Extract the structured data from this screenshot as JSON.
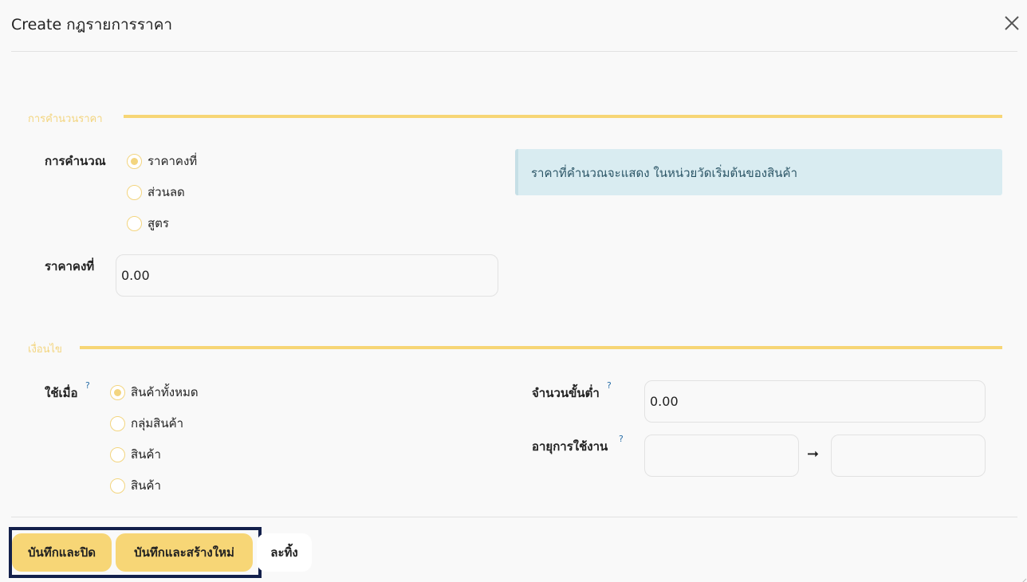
{
  "header": {
    "title": "Create กฎรายการราคา",
    "close_icon": "close-icon"
  },
  "section_calc": {
    "title": "การคำนวนราคา",
    "calc_label": "การคำนวณ",
    "options": [
      {
        "label": "ราคาคงที่",
        "checked": true
      },
      {
        "label": "ส่วนลด",
        "checked": false
      },
      {
        "label": "สูตร",
        "checked": false
      }
    ],
    "info_text": "ราคาที่คำนวณจะแสดง ในหน่วยวัดเริ่มต้นของสินค้า",
    "fixed_price_label": "ราคาคงที่",
    "fixed_price_value": "0.00"
  },
  "section_cond": {
    "title": "เงื่อนไข",
    "apply_label": "ใช้เมื่อ",
    "help_mark": "?",
    "options": [
      {
        "label": "สินค้าทั้งหมด",
        "checked": true
      },
      {
        "label": "กลุ่มสินค้า",
        "checked": false
      },
      {
        "label": "สินค้า",
        "checked": false
      },
      {
        "label": "สินค้า",
        "checked": false
      }
    ],
    "min_qty_label": "จำนวนขั้นต่ำ",
    "min_qty_value": "0.00",
    "validity_label": "อายุการใช้งาน",
    "validity_start": "",
    "validity_end": "",
    "arrow": "➞"
  },
  "footer": {
    "save_close": "บันทึกและปิด",
    "save_new": "บันทึกและสร้างใหม่",
    "discard": "ละทิ้ง"
  },
  "colors": {
    "accent": "#f7d676",
    "info_bg": "#d9ecf1",
    "highlight": "#13204b"
  }
}
